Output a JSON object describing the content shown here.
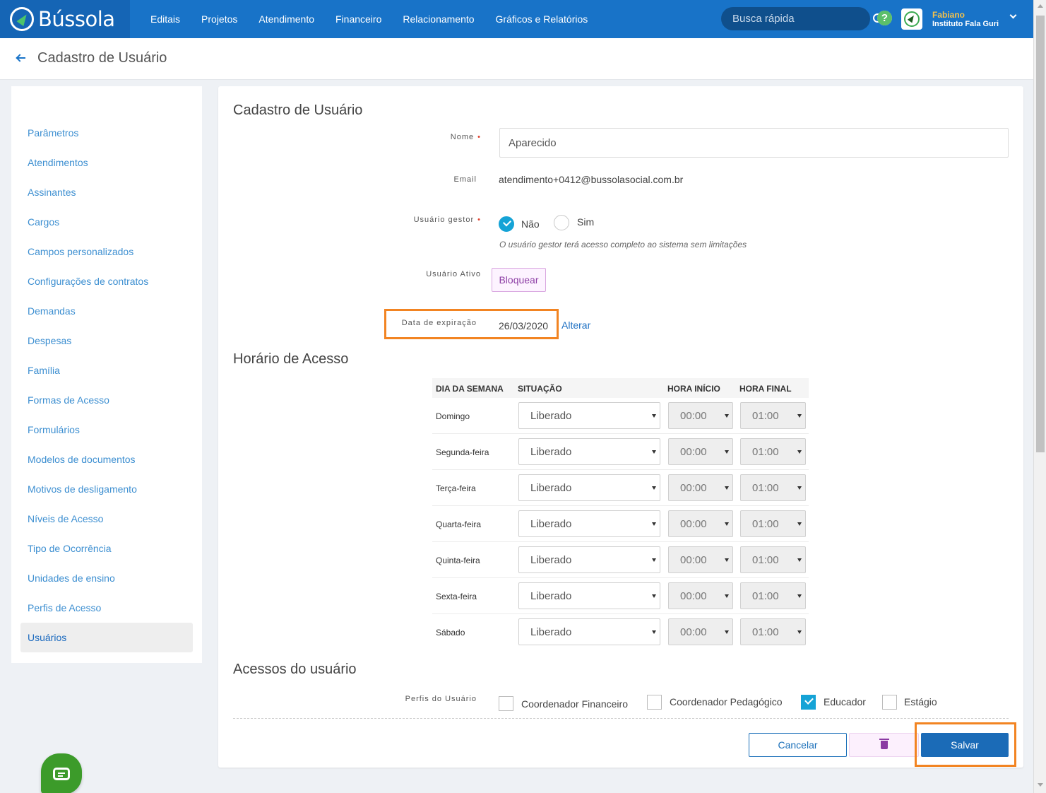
{
  "app": {
    "logo_text": "Bússola",
    "nav": [
      "Editais",
      "Projetos",
      "Atendimento",
      "Financeiro",
      "Relacionamento",
      "Gráficos e Relatórios"
    ],
    "search_placeholder": "Busca rápida",
    "help_glyph": "?",
    "user_name": "Fabiano",
    "user_org": "Instituto Fala Guri"
  },
  "page": {
    "title": "Cadastro de Usuário"
  },
  "sidebar": {
    "items": [
      "Parâmetros",
      "Atendimentos",
      "Assinantes",
      "Cargos",
      "Campos personalizados",
      "Configurações de contratos",
      "Demandas",
      "Despesas",
      "Família",
      "Formas de Acesso",
      "Formulários",
      "Modelos de documentos",
      "Motivos de desligamento",
      "Níveis de Acesso",
      "Tipo de Ocorrência",
      "Unidades de ensino",
      "Perfis de Acesso",
      "Usuários"
    ],
    "active_item": "Usuários"
  },
  "form": {
    "section_title": "Cadastro de Usuário",
    "nome_label": "Nome",
    "nome_value": "Aparecido",
    "email_label": "Email",
    "email_value": "atendimento+0412@bussolasocial.com.br",
    "gestor_label": "Usuário gestor",
    "gestor_options": [
      "Não",
      "Sim"
    ],
    "gestor_selected": "Não",
    "gestor_hint": "O usuário gestor terá acesso completo ao sistema sem limitações",
    "ativo_label": "Usuário Ativo",
    "bloquear_label": "Bloquear",
    "expiracao_label": "Data de expiração",
    "expiracao_value": "26/03/2020",
    "alterar_label": "Alterar",
    "required_mark": "•"
  },
  "access_hours": {
    "section_title": "Horário de Acesso",
    "headers": {
      "day": "DIA DA SEMANA",
      "status": "SITUAÇÃO",
      "start": "HORA INÍCIO",
      "end": "HORA FINAL"
    },
    "rows": [
      {
        "day": "Domingo",
        "status": "Liberado",
        "start": "00:00",
        "end": "01:00"
      },
      {
        "day": "Segunda-feira",
        "status": "Liberado",
        "start": "00:00",
        "end": "01:00"
      },
      {
        "day": "Terça-feira",
        "status": "Liberado",
        "start": "00:00",
        "end": "01:00"
      },
      {
        "day": "Quarta-feira",
        "status": "Liberado",
        "start": "00:00",
        "end": "01:00"
      },
      {
        "day": "Quinta-feira",
        "status": "Liberado",
        "start": "00:00",
        "end": "01:00"
      },
      {
        "day": "Sexta-feira",
        "status": "Liberado",
        "start": "00:00",
        "end": "01:00"
      },
      {
        "day": "Sábado",
        "status": "Liberado",
        "start": "00:00",
        "end": "01:00"
      }
    ]
  },
  "user_access": {
    "section_title": "Acessos do usuário",
    "profiles_label": "Perfis do Usuário",
    "profiles": [
      {
        "label": "Coordenador Financeiro",
        "checked": false
      },
      {
        "label": "Coordenador Pedagógico",
        "checked": false
      },
      {
        "label": "Educador",
        "checked": true
      },
      {
        "label": "Estágio",
        "checked": false
      }
    ]
  },
  "actions": {
    "cancel_label": "Cancelar",
    "save_label": "Salvar"
  },
  "colors": {
    "primary": "#1873c8",
    "accent_check": "#15a3d6",
    "highlight": "#f28422",
    "delete": "#8b3aa3",
    "chat": "#3c9b2a"
  }
}
